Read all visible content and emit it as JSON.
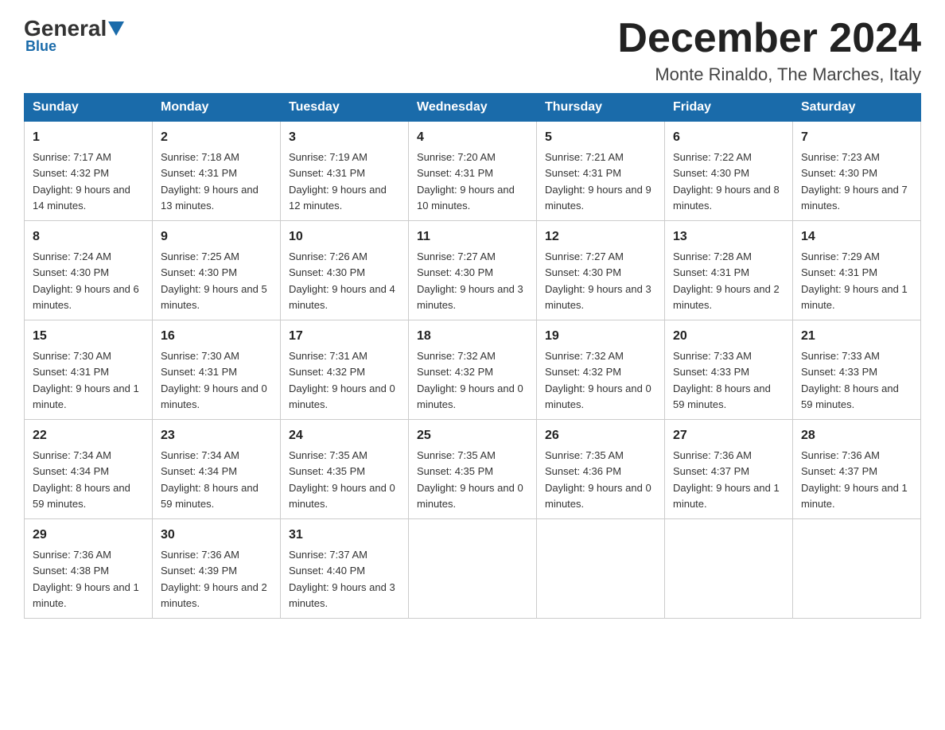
{
  "logo": {
    "general": "General",
    "blue": "Blue",
    "triangle": "▶"
  },
  "header": {
    "month_title": "December 2024",
    "location": "Monte Rinaldo, The Marches, Italy"
  },
  "weekdays": [
    "Sunday",
    "Monday",
    "Tuesday",
    "Wednesday",
    "Thursday",
    "Friday",
    "Saturday"
  ],
  "weeks": [
    [
      {
        "day": "1",
        "sunrise": "7:17 AM",
        "sunset": "4:32 PM",
        "daylight": "9 hours and 14 minutes."
      },
      {
        "day": "2",
        "sunrise": "7:18 AM",
        "sunset": "4:31 PM",
        "daylight": "9 hours and 13 minutes."
      },
      {
        "day": "3",
        "sunrise": "7:19 AM",
        "sunset": "4:31 PM",
        "daylight": "9 hours and 12 minutes."
      },
      {
        "day": "4",
        "sunrise": "7:20 AM",
        "sunset": "4:31 PM",
        "daylight": "9 hours and 10 minutes."
      },
      {
        "day": "5",
        "sunrise": "7:21 AM",
        "sunset": "4:31 PM",
        "daylight": "9 hours and 9 minutes."
      },
      {
        "day": "6",
        "sunrise": "7:22 AM",
        "sunset": "4:30 PM",
        "daylight": "9 hours and 8 minutes."
      },
      {
        "day": "7",
        "sunrise": "7:23 AM",
        "sunset": "4:30 PM",
        "daylight": "9 hours and 7 minutes."
      }
    ],
    [
      {
        "day": "8",
        "sunrise": "7:24 AM",
        "sunset": "4:30 PM",
        "daylight": "9 hours and 6 minutes."
      },
      {
        "day": "9",
        "sunrise": "7:25 AM",
        "sunset": "4:30 PM",
        "daylight": "9 hours and 5 minutes."
      },
      {
        "day": "10",
        "sunrise": "7:26 AM",
        "sunset": "4:30 PM",
        "daylight": "9 hours and 4 minutes."
      },
      {
        "day": "11",
        "sunrise": "7:27 AM",
        "sunset": "4:30 PM",
        "daylight": "9 hours and 3 minutes."
      },
      {
        "day": "12",
        "sunrise": "7:27 AM",
        "sunset": "4:30 PM",
        "daylight": "9 hours and 3 minutes."
      },
      {
        "day": "13",
        "sunrise": "7:28 AM",
        "sunset": "4:31 PM",
        "daylight": "9 hours and 2 minutes."
      },
      {
        "day": "14",
        "sunrise": "7:29 AM",
        "sunset": "4:31 PM",
        "daylight": "9 hours and 1 minute."
      }
    ],
    [
      {
        "day": "15",
        "sunrise": "7:30 AM",
        "sunset": "4:31 PM",
        "daylight": "9 hours and 1 minute."
      },
      {
        "day": "16",
        "sunrise": "7:30 AM",
        "sunset": "4:31 PM",
        "daylight": "9 hours and 0 minutes."
      },
      {
        "day": "17",
        "sunrise": "7:31 AM",
        "sunset": "4:32 PM",
        "daylight": "9 hours and 0 minutes."
      },
      {
        "day": "18",
        "sunrise": "7:32 AM",
        "sunset": "4:32 PM",
        "daylight": "9 hours and 0 minutes."
      },
      {
        "day": "19",
        "sunrise": "7:32 AM",
        "sunset": "4:32 PM",
        "daylight": "9 hours and 0 minutes."
      },
      {
        "day": "20",
        "sunrise": "7:33 AM",
        "sunset": "4:33 PM",
        "daylight": "8 hours and 59 minutes."
      },
      {
        "day": "21",
        "sunrise": "7:33 AM",
        "sunset": "4:33 PM",
        "daylight": "8 hours and 59 minutes."
      }
    ],
    [
      {
        "day": "22",
        "sunrise": "7:34 AM",
        "sunset": "4:34 PM",
        "daylight": "8 hours and 59 minutes."
      },
      {
        "day": "23",
        "sunrise": "7:34 AM",
        "sunset": "4:34 PM",
        "daylight": "8 hours and 59 minutes."
      },
      {
        "day": "24",
        "sunrise": "7:35 AM",
        "sunset": "4:35 PM",
        "daylight": "9 hours and 0 minutes."
      },
      {
        "day": "25",
        "sunrise": "7:35 AM",
        "sunset": "4:35 PM",
        "daylight": "9 hours and 0 minutes."
      },
      {
        "day": "26",
        "sunrise": "7:35 AM",
        "sunset": "4:36 PM",
        "daylight": "9 hours and 0 minutes."
      },
      {
        "day": "27",
        "sunrise": "7:36 AM",
        "sunset": "4:37 PM",
        "daylight": "9 hours and 1 minute."
      },
      {
        "day": "28",
        "sunrise": "7:36 AM",
        "sunset": "4:37 PM",
        "daylight": "9 hours and 1 minute."
      }
    ],
    [
      {
        "day": "29",
        "sunrise": "7:36 AM",
        "sunset": "4:38 PM",
        "daylight": "9 hours and 1 minute."
      },
      {
        "day": "30",
        "sunrise": "7:36 AM",
        "sunset": "4:39 PM",
        "daylight": "9 hours and 2 minutes."
      },
      {
        "day": "31",
        "sunrise": "7:37 AM",
        "sunset": "4:40 PM",
        "daylight": "9 hours and 3 minutes."
      },
      null,
      null,
      null,
      null
    ]
  ]
}
